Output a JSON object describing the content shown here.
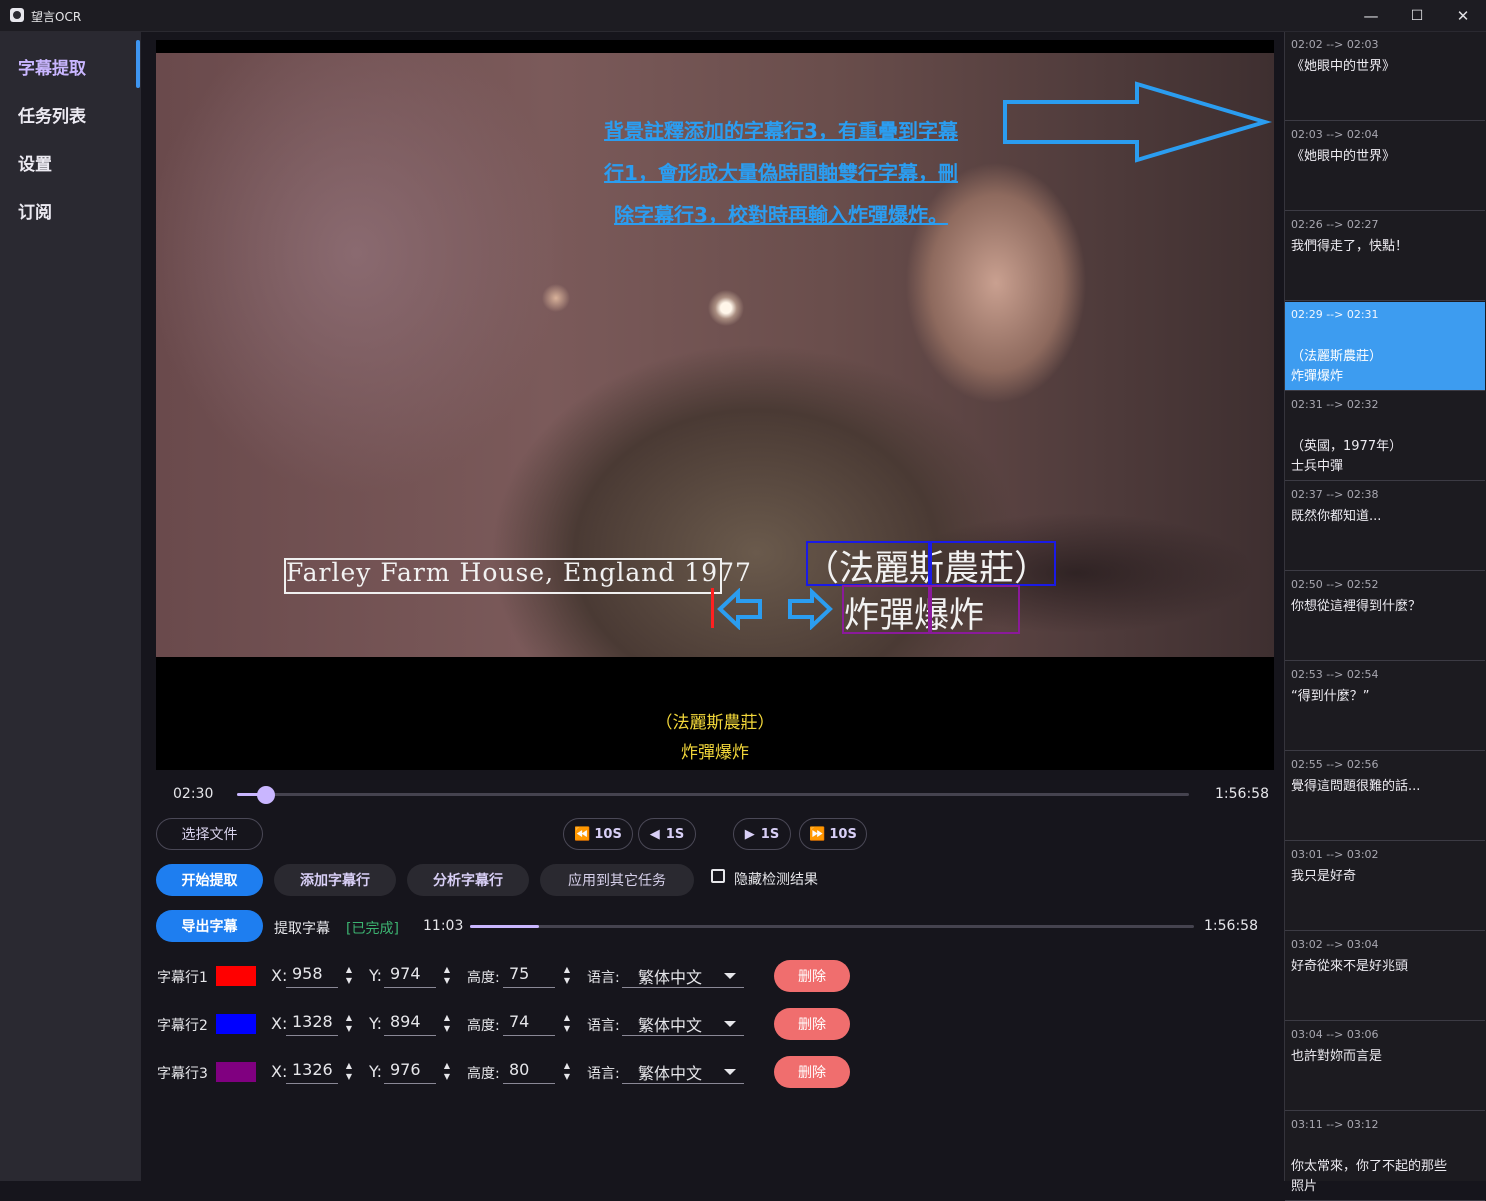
{
  "window": {
    "title": "望言OCR",
    "controls": {
      "minimize": "—",
      "maximize": "☐",
      "close": "✕"
    }
  },
  "sidebar": {
    "items": [
      {
        "label": "字幕提取"
      },
      {
        "label": "任务列表"
      },
      {
        "label": "设置"
      },
      {
        "label": "订阅"
      }
    ]
  },
  "video": {
    "annotation_lines": [
      "背景註釋添加的字幕行3，有重疊到字幕",
      "行1，會形成大量偽時間軸雙行字幕，刪",
      "除字幕行3，校對時再輸入炸彈爆炸。"
    ],
    "overlay_text_1": "Farley Farm House, England 1977",
    "overlay_text_2": "（法麗斯農莊）",
    "overlay_text_3": "炸彈爆炸",
    "subtitle_line_1": "（法麗斯農莊）",
    "subtitle_line_2": "炸彈爆炸"
  },
  "player": {
    "current_time": "02:30",
    "total_time": "1:56:58",
    "progress_fraction": 0.02
  },
  "controls": {
    "select_file": "选择文件",
    "back_10s": "10S",
    "back_1s": "1S",
    "fwd_1s": "1S",
    "fwd_10s": "10S",
    "start_extract": "开始提取",
    "add_line": "添加字幕行",
    "analyze_line": "分析字幕行",
    "apply_other": "应用到其它任务",
    "hide_detect": "隐藏检测结果",
    "export": "导出字幕"
  },
  "extract_progress": {
    "label": "提取字幕",
    "status": "[已完成]",
    "current": "11:03",
    "total": "1:56:58",
    "fraction": 0.095
  },
  "subtitle_rows": [
    {
      "name": "字幕行1",
      "color": "#ff0000",
      "x": "958",
      "y": "974",
      "height": "75",
      "language": "繁体中文",
      "delete": "删除"
    },
    {
      "name": "字幕行2",
      "color": "#0000ff",
      "x": "1328",
      "y": "894",
      "height": "74",
      "language": "繁体中文",
      "delete": "删除"
    },
    {
      "name": "字幕行3",
      "color": "#800080",
      "x": "1326",
      "y": "976",
      "height": "80",
      "language": "繁体中文",
      "delete": "删除"
    }
  ],
  "field_labels": {
    "x": "X:",
    "y": "Y:",
    "height": "高度:",
    "language": "语言:"
  },
  "results": [
    {
      "time": "02:02 --> 02:03",
      "text": "《她眼中的世界》"
    },
    {
      "time": "02:03 --> 02:04",
      "text": "《她眼中的世界》"
    },
    {
      "time": "02:26 --> 02:27",
      "text": "我們得走了，快點！"
    },
    {
      "time": "02:29 --> 02:31",
      "text": "（法麗斯農莊）\n炸彈爆炸"
    },
    {
      "time": "02:31 --> 02:32",
      "text": "（英國，1977年）\n士兵中彈"
    },
    {
      "time": "02:37 --> 02:38",
      "text": "既然你都知道..."
    },
    {
      "time": "02:50 --> 02:52",
      "text": "你想從這裡得到什麼？"
    },
    {
      "time": "02:53 --> 02:54",
      "text": "“得到什麼？”"
    },
    {
      "time": "02:55 --> 02:56",
      "text": "覺得這問題很難的話..."
    },
    {
      "time": "03:01 --> 03:02",
      "text": "我只是好奇"
    },
    {
      "time": "03:02 --> 03:04",
      "text": "好奇從來不是好兆頭"
    },
    {
      "time": "03:04 --> 03:06",
      "text": "也許對妳而言是"
    },
    {
      "time": "03:11 --> 03:12",
      "text": "你太常來，你了不起的那些\n照片"
    }
  ],
  "colors": {
    "accent": "#c9b6ff",
    "primary_button": "#1e7ef0",
    "delete_button": "#f06e6e",
    "selected_entry": "#3d9cf0",
    "annotation": "#2b9df0",
    "subtitle": "#f2d73a"
  }
}
